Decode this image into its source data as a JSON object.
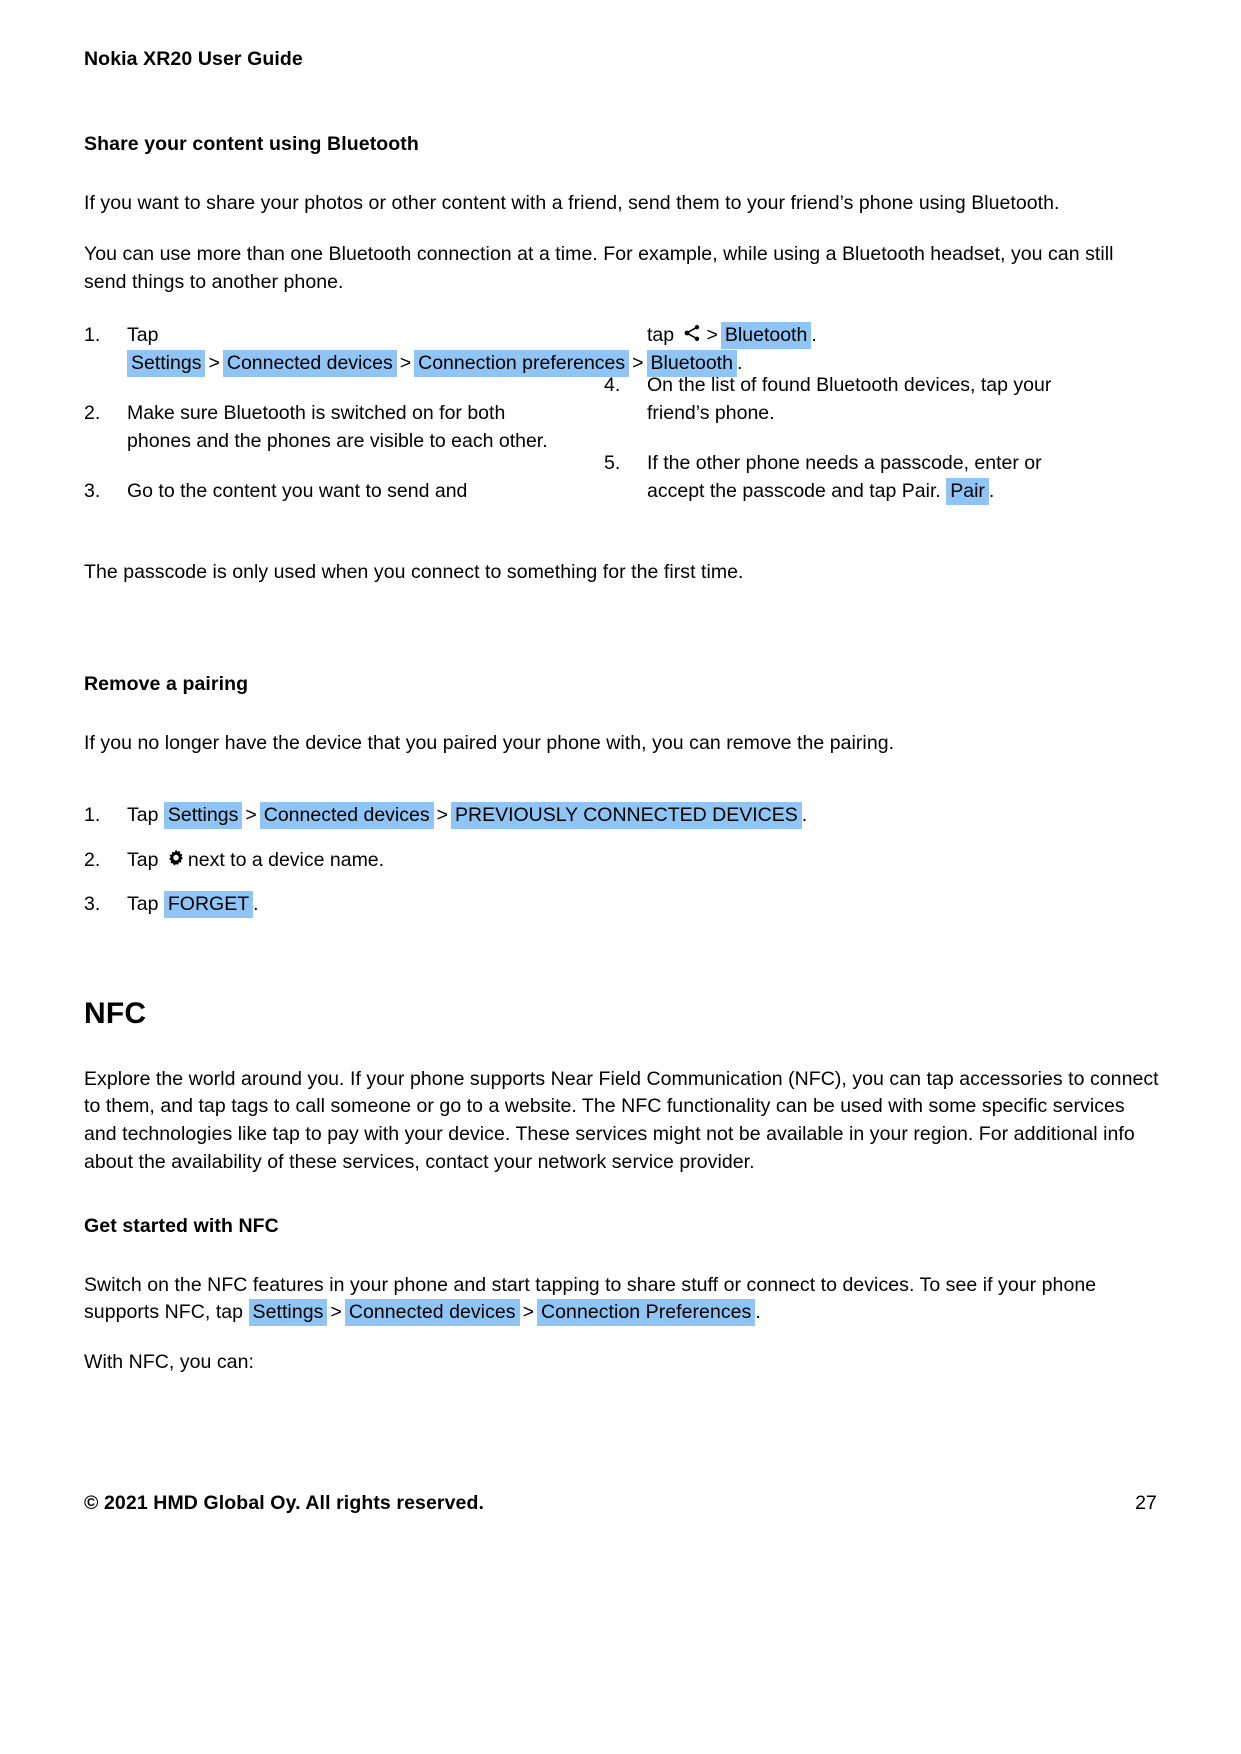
{
  "document": {
    "running_head": "Nokia XR20 User Guide",
    "highlight_color": "#8fc4f4"
  },
  "bluetooth_share": {
    "heading": "Share your content using Bluetooth",
    "intro1": "If you want to share your photos or other content with a friend, send them to your friend’s phone using Bluetooth.",
    "intro2": "You can use more than one Bluetooth connection at a time. For example, while using a Bluetooth headset, you can still send things to another phone.",
    "steps_left": [
      {
        "num": "1.",
        "prefix": "Tap",
        "path": [
          "Settings",
          "Connected devices",
          "Connection preferences",
          "Bluetooth"
        ],
        "separator": ">",
        "suffix": "."
      },
      {
        "num": "2.",
        "text": "Make sure Bluetooth is switched on for both phones and the phones are visible to each other."
      },
      {
        "num": "3.",
        "text": "Go to the content you want to send and"
      }
    ],
    "continuation": {
      "prefix": "tap",
      "icon": "share-icon",
      "separator": ">",
      "chip": "Bluetooth",
      "suffix": "."
    },
    "steps_right": [
      {
        "num": "4.",
        "text": "On the list of found Bluetooth devices, tap your friend’s phone."
      },
      {
        "num": "5.",
        "text_before": "If the other phone needs a passcode, enter or accept the passcode and tap Pair.",
        "chip": "Pair",
        "suffix": "."
      }
    ],
    "outro": "The passcode is only used when you connect to something for the first time."
  },
  "remove_pairing": {
    "heading": "Remove a pairing",
    "intro": "If you no longer have the device that you paired your phone with, you can remove the pairing.",
    "steps": [
      {
        "num": "1.",
        "prefix": "Tap",
        "path": [
          "Settings",
          "Connected devices",
          "PREVIOUSLY CONNECTED DEVICES"
        ],
        "separator": ">",
        "suffix": "."
      },
      {
        "num": "2.",
        "prefix": "Tap",
        "icon": "gear-icon",
        "text_after": "next to a device name."
      },
      {
        "num": "3.",
        "prefix": "Tap",
        "chip": "FORGET",
        "suffix": "."
      }
    ]
  },
  "nfc": {
    "heading": "NFC",
    "body": "Explore the world around you. If your phone supports Near Field Communication (NFC), you can tap accessories to connect to them, and tap tags to call someone or go to a website. The NFC functionality can be used with some specific services and technologies like tap to pay with your device. These services might not be available in your region. For additional info about the availability of these services, contact your network service provider.",
    "subheading": "Get started with NFC",
    "body2_before": "Switch on the NFC features in your phone and start tapping to share stuff or connect to devices. To see if your phone supports NFC, tap",
    "path": [
      "Settings",
      "Connected devices",
      "Connection Preferences"
    ],
    "separator": ">",
    "suffix": ".",
    "closing": "With NFC, you can:"
  },
  "footer": {
    "copyright": "© 2021 HMD Global Oy. All rights reserved.",
    "page_number": "27"
  }
}
